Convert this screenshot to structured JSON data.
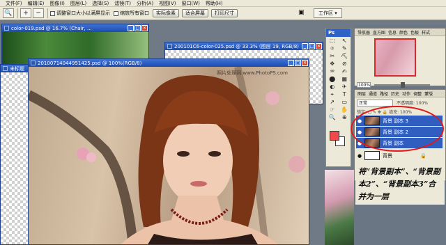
{
  "menu": [
    "文件(F)",
    "编辑(E)",
    "图像(I)",
    "图层(L)",
    "选择(S)",
    "滤镜(T)",
    "分析(A)",
    "视图(V)",
    "窗口(W)",
    "帮助(H)"
  ],
  "options": {
    "check1": "调整窗口大小以满屏显示",
    "check2": "缩放所有窗口",
    "btn1": "实际像素",
    "btn2": "适合屏幕",
    "btn3": "打印尺寸",
    "workspace": "工作区 ▾"
  },
  "windows": {
    "back1": "color-019.psd @ 16.7% (Chair, ...",
    "back2": "200101C6-color-025.psd @ 33.3% (图层 19, RGB/8)",
    "back3": "未标题",
    "main": "20100714044951425.psd @ 100%(RGB/8)",
    "watermark": "照片处理网 www.PhotoPS.com"
  },
  "toolbox": {
    "head": "Ps",
    "tools": [
      "⬚",
      "↖",
      "⌾",
      "✎",
      "✂",
      "⛏",
      "✥",
      "⊘",
      "♒",
      "✍",
      "⬤",
      "▦",
      "◐",
      "✈",
      "⌖",
      "T",
      "↗",
      "▭",
      "☞",
      "✋",
      "🔍",
      "⊕"
    ]
  },
  "navigator": {
    "tabs": [
      "导航器",
      "直方图",
      "信息",
      "颜色",
      "色板",
      "样式"
    ],
    "zoom": "100%"
  },
  "layers": {
    "tabs": [
      "图层",
      "通道",
      "路径",
      "历史",
      "动作",
      "调整",
      "蒙版"
    ],
    "mode": "正常",
    "opacity_label": "不透明度: 100%",
    "lock_label": "锁定: ◻ ✎ ✥ 🔒  填充: 100%",
    "rows": [
      {
        "name": "背景 副本 3",
        "selected": true
      },
      {
        "name": "背景 副本 2",
        "selected": true
      },
      {
        "name": "背景 副本",
        "selected": true
      },
      {
        "name": "背景",
        "selected": false
      }
    ]
  },
  "annotation": "将“背景副本”、“背景副本2”、“背景副本3”合并为一层",
  "colors": {
    "selection": "#2f5ec0",
    "ellipse": "#e11919",
    "foreground": "#f0494a",
    "titlebar": "#2a5ec9"
  }
}
